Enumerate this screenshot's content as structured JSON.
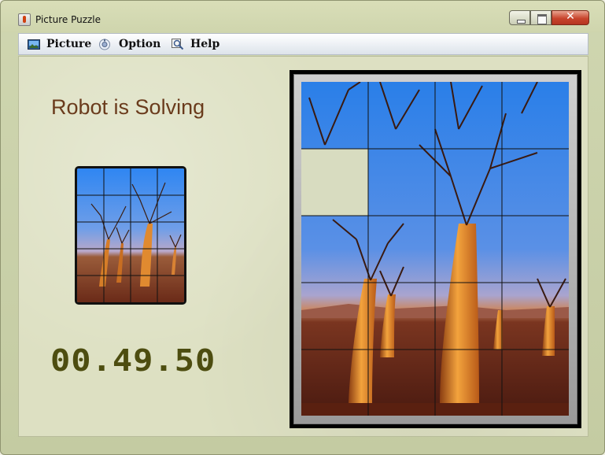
{
  "window": {
    "title": "Picture Puzzle"
  },
  "menu": {
    "items": [
      {
        "label": "Picture",
        "icon": "picture-icon"
      },
      {
        "label": "Option",
        "icon": "option-icon"
      },
      {
        "label": "Help",
        "icon": "help-icon"
      }
    ]
  },
  "game": {
    "status": "Robot is Solving",
    "timer": "00.49.50",
    "grid": {
      "rows": 5,
      "cols": 4,
      "empty_tile": {
        "row": 1,
        "col": 0
      }
    },
    "colors": {
      "status_text": "#6a3b1c",
      "timer_text": "#4d4d10",
      "empty_tile": "#d8dcc0",
      "sky": "#3f8ff0"
    }
  }
}
